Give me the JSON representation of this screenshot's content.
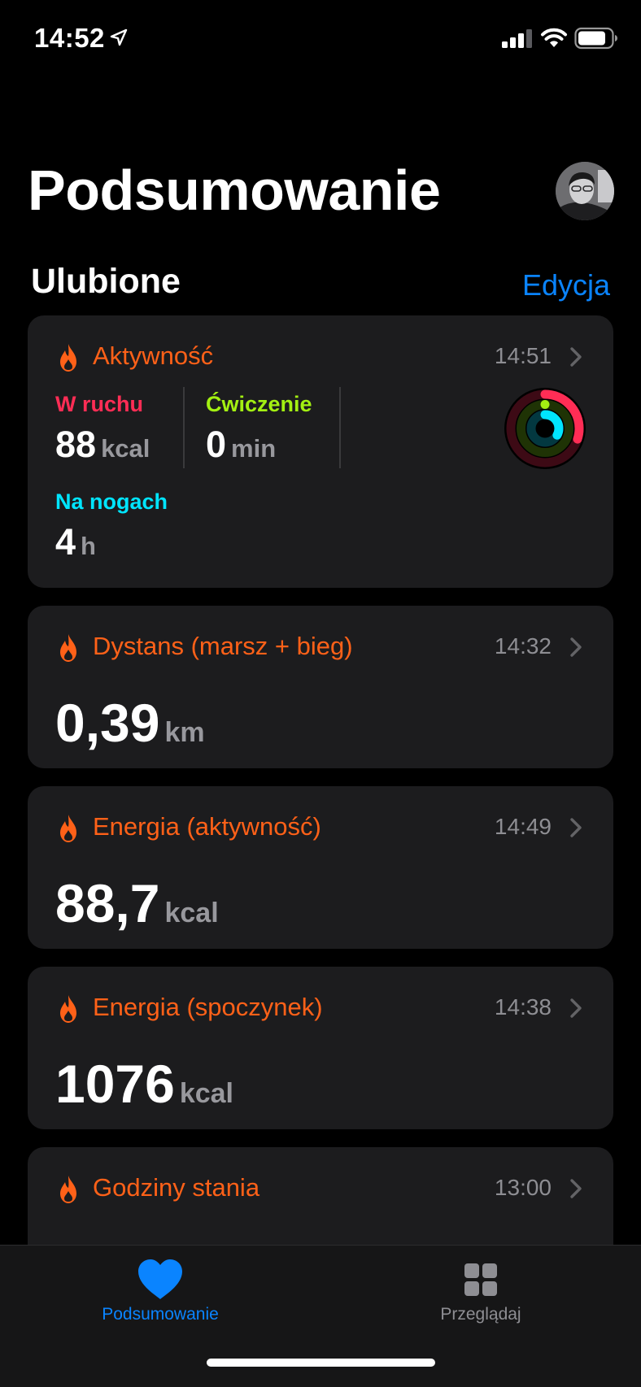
{
  "status_bar": {
    "time": "14:52",
    "icons": [
      "location-arrow-icon",
      "cellular-signal-icon",
      "wifi-icon",
      "battery-icon"
    ]
  },
  "header": {
    "title": "Podsumowanie",
    "avatar": "profile-photo"
  },
  "favorites": {
    "title": "Ulubione",
    "edit_label": "Edycja"
  },
  "activity_card": {
    "title": "Aktywność",
    "time": "14:51",
    "icon": "flame-icon",
    "move": {
      "label": "W ruchu",
      "value": "88",
      "unit": "kcal",
      "color": "#ff2d55"
    },
    "exercise": {
      "label": "Ćwiczenie",
      "value": "0",
      "unit": "min",
      "color": "#a3f012"
    },
    "stand": {
      "label": "Na nogach",
      "value": "4",
      "unit": "h",
      "color": "#00e5ff"
    },
    "rings": {
      "move_progress": 0.3,
      "exercise_progress": 0.0,
      "stand_progress": 0.33
    }
  },
  "cards": [
    {
      "title": "Dystans (marsz + bieg)",
      "time": "14:32",
      "value": "0,39",
      "unit": "km",
      "icon": "flame-icon"
    },
    {
      "title": "Energia (aktywność)",
      "time": "14:49",
      "value": "88,7",
      "unit": "kcal",
      "icon": "flame-icon"
    },
    {
      "title": "Energia (spoczynek)",
      "time": "14:38",
      "value": "1076",
      "unit": "kcal",
      "icon": "flame-icon"
    },
    {
      "title": "Godziny stania",
      "time": "13:00",
      "value": "",
      "unit": "",
      "icon": "flame-icon"
    }
  ],
  "tab_bar": {
    "tabs": [
      {
        "label": "Podsumowanie",
        "icon": "heart-icon",
        "active": true
      },
      {
        "label": "Przeglądaj",
        "icon": "grid-icon",
        "active": false
      }
    ]
  },
  "colors": {
    "accent": "#0a84ff",
    "orange": "#ff6118",
    "card_background": "#1c1c1e",
    "secondary_text": "#8e8e93"
  }
}
